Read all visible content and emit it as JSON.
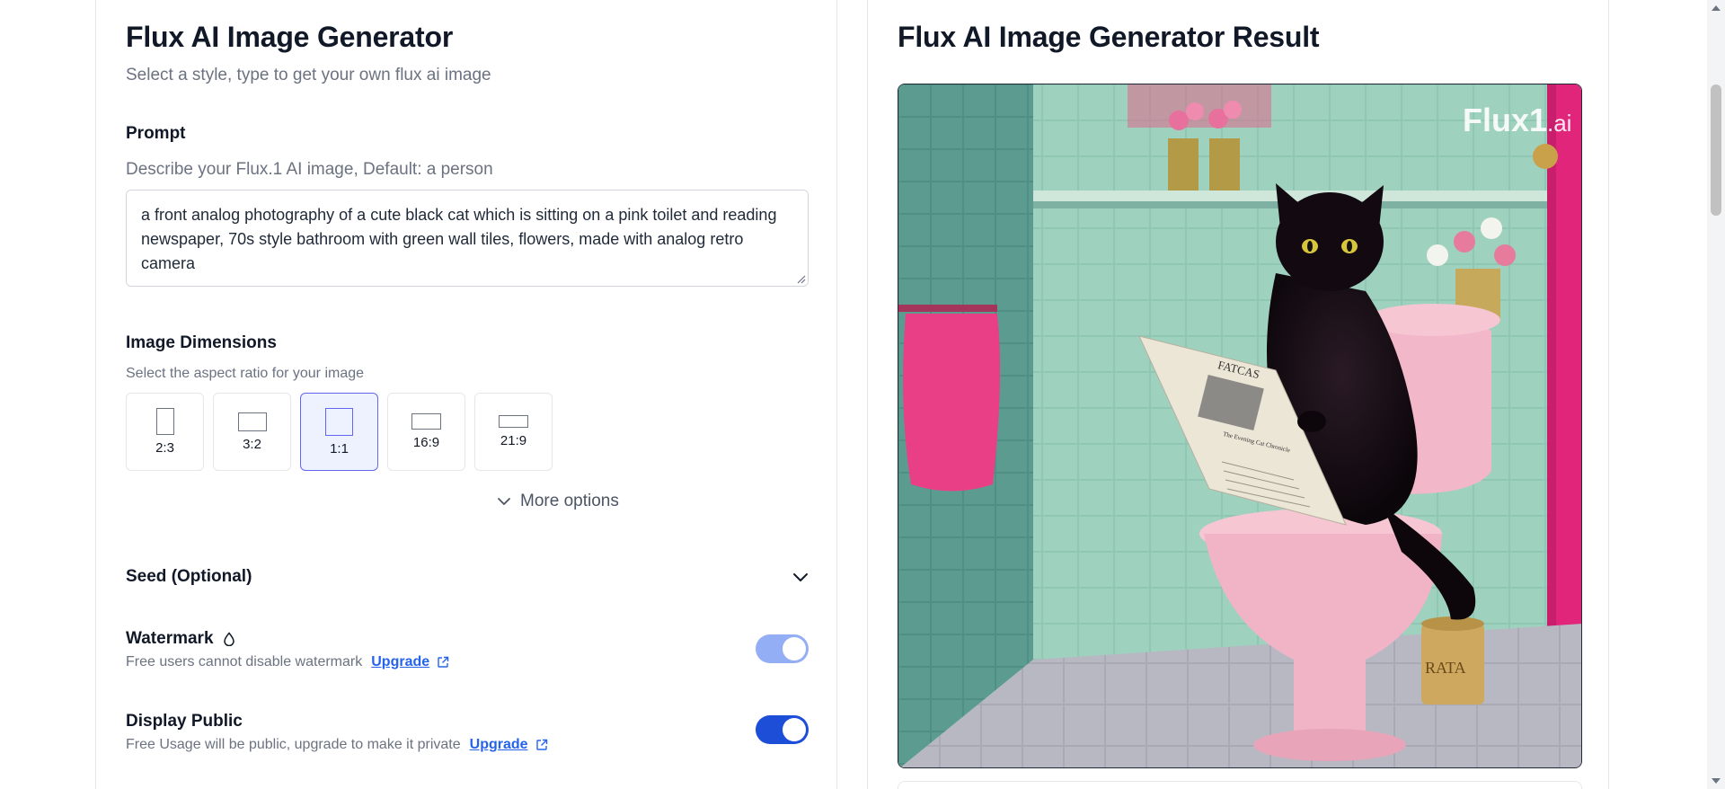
{
  "left_panel": {
    "title": "Flux AI Image Generator",
    "subtitle": "Select a style, type to get your own flux ai image",
    "prompt": {
      "label": "Prompt",
      "hint": "Describe your Flux.1 AI image, Default: a person",
      "value": "a front analog photography of a cute black cat which is sitting on a pink toilet and reading newspaper, 70s style bathroom with green wall tiles, flowers, made with analog retro camera"
    },
    "dimensions": {
      "label": "Image Dimensions",
      "hint": "Select the aspect ratio for your image",
      "options": [
        {
          "label": "2:3",
          "selected": false
        },
        {
          "label": "3:2",
          "selected": false
        },
        {
          "label": "1:1",
          "selected": true
        },
        {
          "label": "16:9",
          "selected": false
        },
        {
          "label": "21:9",
          "selected": false
        }
      ],
      "more_options": "More options"
    },
    "seed": {
      "label": "Seed (Optional)"
    },
    "watermark": {
      "label": "Watermark",
      "description": "Free users cannot disable watermark",
      "link": "Upgrade",
      "enabled": true,
      "disabled": true
    },
    "display_public": {
      "label": "Display Public",
      "description": "Free Usage will be public, upgrade to make it private",
      "link": "Upgrade",
      "enabled": true
    }
  },
  "right_panel": {
    "title": "Flux AI Image Generator Result",
    "image_watermark": {
      "brand": "Flux1",
      "suffix": ".ai"
    },
    "image_texts": {
      "newspaper_masthead": "FATCAS",
      "newspaper_headline": "The Evening Cat Chronicle",
      "can_label": "RATA"
    }
  },
  "colors": {
    "accent": "#6366f1",
    "link": "#2563eb",
    "toggle_on": "#1d4ed8",
    "toggle_disabled": "#93aef5",
    "muted_text": "#6b7280"
  }
}
